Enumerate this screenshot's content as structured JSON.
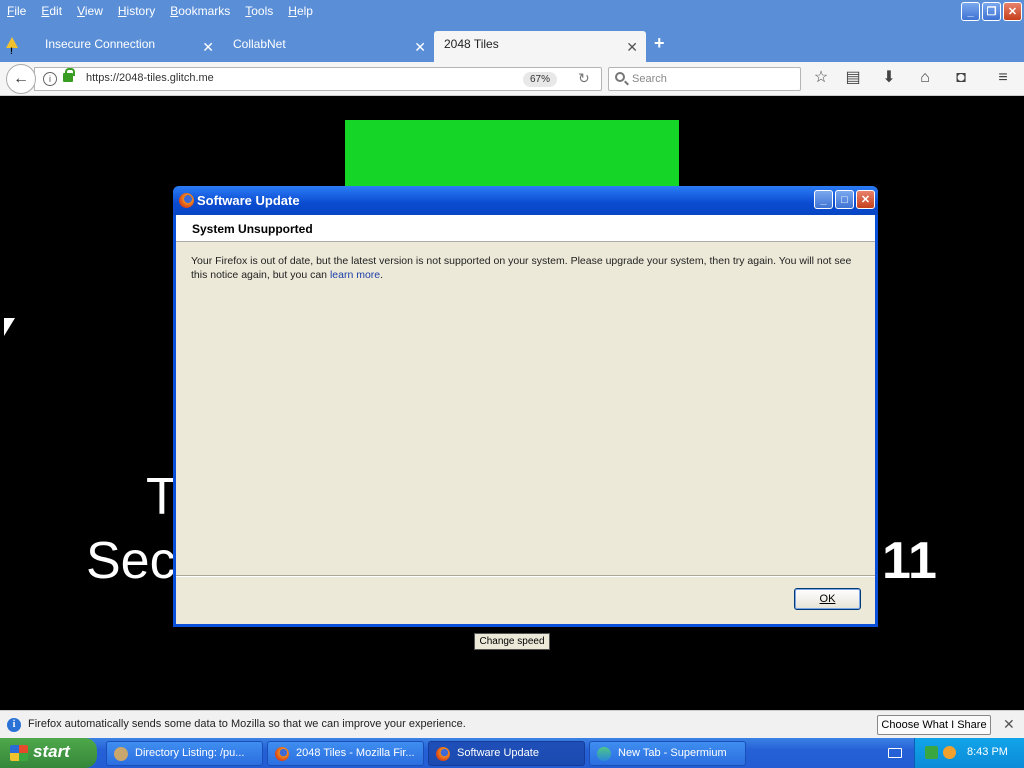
{
  "menubar": {
    "items": [
      "File",
      "Edit",
      "View",
      "History",
      "Bookmarks",
      "Tools",
      "Help"
    ]
  },
  "tabs": [
    {
      "label": "Insecure Connection",
      "warning": true
    },
    {
      "label": "CollabNet"
    },
    {
      "label": "2048 Tiles",
      "active": true
    }
  ],
  "navbar": {
    "url": "https://2048-tiles.glitch.me",
    "zoom": "67%",
    "search_placeholder": "Search"
  },
  "page": {
    "text_t": "T",
    "text_sec": "Sec",
    "text_11": "11",
    "change_speed_label": "Change speed",
    "green_block_color": "#15d627"
  },
  "dialog": {
    "title": "Software Update",
    "heading": "System Unsupported",
    "message": "Your Firefox is out of date, but the latest version is not supported on your system. Please upgrade your system, then try again. You will not see this notice again, but you can ",
    "link_text": "learn more",
    "message_end": ".",
    "ok_label": "OK"
  },
  "notification": {
    "text": "Firefox automatically sends some data to Mozilla so that we can improve your experience.",
    "button_label": "Choose What I Share"
  },
  "taskbar": {
    "start_label": "start",
    "tasks": [
      {
        "label": "Directory Listing: /pu..."
      },
      {
        "label": "2048 Tiles - Mozilla Fir..."
      },
      {
        "label": "Software Update",
        "active": true
      },
      {
        "label": "New Tab - Supermium"
      }
    ],
    "clock": "8:43 PM"
  }
}
